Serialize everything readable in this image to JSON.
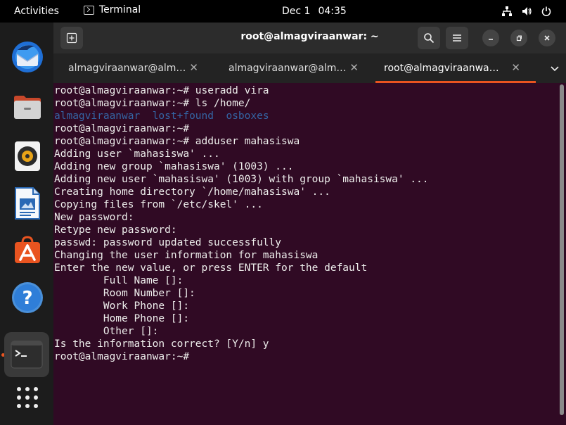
{
  "topbar": {
    "activities": "Activities",
    "app_name": "Terminal",
    "date": "Dec 1",
    "time": "04:35",
    "icons": [
      "network-icon",
      "volume-icon",
      "power-icon"
    ]
  },
  "dock": {
    "apps": [
      "thunderbird",
      "files",
      "rhythmbox",
      "libreoffice-writer",
      "ubuntu-software",
      "help",
      "terminal",
      "show-applications"
    ]
  },
  "window": {
    "title": "root@almagviraanwar: ~",
    "tabs": [
      {
        "label": "almagviraanwar@alm…"
      },
      {
        "label": "almagviraanwar@alm…"
      },
      {
        "label": "root@almagviraanwa…"
      }
    ]
  },
  "terminal": {
    "colors": {
      "background": "#300a24",
      "foreground": "#eeeeec",
      "directory": "#3465a4"
    },
    "lines": [
      "root@almagviraanwar:~# useradd vira",
      "root@almagviraanwar:~# ls /home/",
      "",
      "root@almagviraanwar:~#",
      "root@almagviraanwar:~# adduser mahasiswa",
      "Adding user `mahasiswa' ...",
      "Adding new group `mahasiswa' (1003) ...",
      "Adding new user `mahasiswa' (1003) with group `mahasiswa' ...",
      "Creating home directory `/home/mahasiswa' ...",
      "Copying files from `/etc/skel' ...",
      "New password:",
      "Retype new password:",
      "passwd: password updated successfully",
      "Changing the user information for mahasiswa",
      "Enter the new value, or press ENTER for the default",
      "        Full Name []:",
      "        Room Number []:",
      "        Work Phone []:",
      "        Home Phone []:",
      "        Other []:",
      "Is the information correct? [Y/n] y",
      "root@almagviraanwar:~#"
    ],
    "ls_dirs": [
      "almagviraanwar",
      "lost+found",
      "osboxes"
    ]
  }
}
